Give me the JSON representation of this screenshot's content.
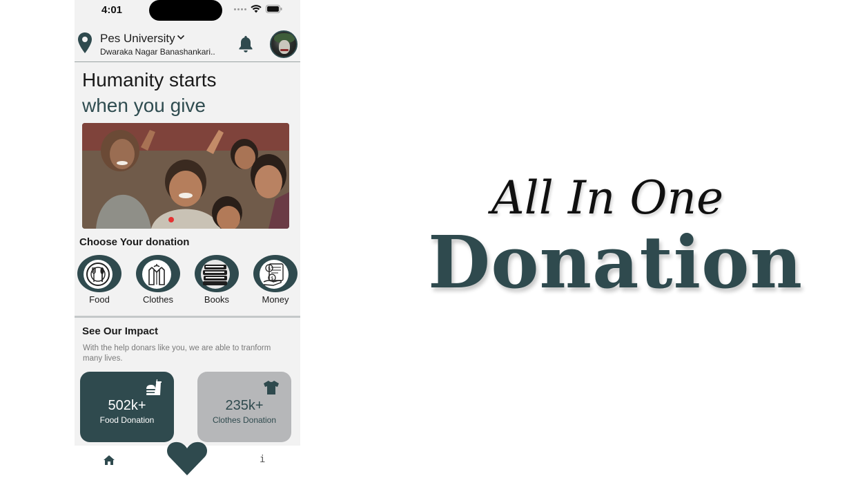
{
  "status_bar": {
    "time": "4:01"
  },
  "header": {
    "location_title": "Pes University",
    "location_subtitle": "Dwaraka Nagar Banashankari.."
  },
  "hero": {
    "title": "Humanity starts",
    "subtitle": "when you give"
  },
  "categories": {
    "label": "Choose Your donation",
    "items": [
      {
        "label": "Food",
        "icon": "food-icon"
      },
      {
        "label": "Clothes",
        "icon": "clothes-icon"
      },
      {
        "label": "Books",
        "icon": "books-icon"
      },
      {
        "label": "Money",
        "icon": "money-icon"
      }
    ]
  },
  "impact": {
    "title": "See Our Impact",
    "description": "With the help donars like you, we are able to tranform many lives.",
    "stats": [
      {
        "value": "502k+",
        "label": "Food Donation",
        "icon": "fastfood-icon"
      },
      {
        "value": "235k+",
        "label": "Clothes Donation",
        "icon": "shirt-icon"
      }
    ]
  },
  "bottom_nav": {
    "items": [
      {
        "icon": "home-icon"
      },
      {
        "icon": "heart-icon"
      },
      {
        "icon": "info-icon",
        "label": "i"
      }
    ]
  },
  "brand": {
    "line1": "All In One",
    "line2": "Donation"
  },
  "colors": {
    "primary": "#2f4a4e",
    "background": "#f2f2f2",
    "accent_dot": "#e53232",
    "secondary_card": "#b6b7b9"
  }
}
